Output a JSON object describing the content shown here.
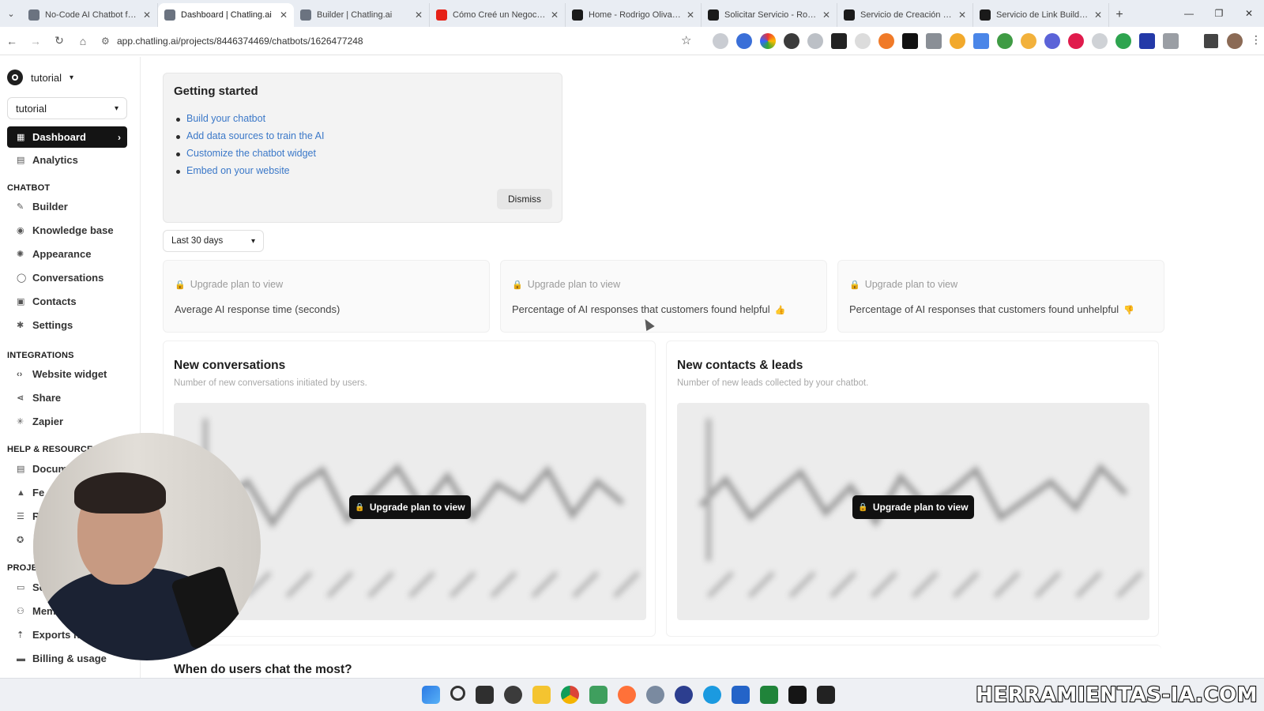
{
  "browser": {
    "tabs": [
      {
        "title": "No-Code AI Chatbot for W",
        "color": "#6b7380",
        "active": false
      },
      {
        "title": "Dashboard | Chatling.ai",
        "color": "#6b7380",
        "active": true
      },
      {
        "title": "Builder | Chatling.ai",
        "color": "#6b7380",
        "active": false
      },
      {
        "title": "Cómo Creé un Negocio d",
        "color": "#e62117",
        "active": false
      },
      {
        "title": "Home - Rodrigo Olivares",
        "color": "#1a1a1a",
        "active": false
      },
      {
        "title": "Solicitar Servicio - Rodrig",
        "color": "#1a1a1a",
        "active": false
      },
      {
        "title": "Servicio de Creación de C",
        "color": "#1a1a1a",
        "active": false
      },
      {
        "title": "Servicio de Link Building",
        "color": "#1a1a1a",
        "active": false
      }
    ],
    "new_tab": "+",
    "url": "app.chatling.ai/projects/8446374469/chatbots/1626477248"
  },
  "sidebar": {
    "workspace": "tutorial",
    "project_select": "tutorial",
    "main_items": [
      {
        "label": "Dashboard",
        "icon": "grid-icon",
        "active": true
      },
      {
        "label": "Analytics",
        "icon": "chart-icon",
        "active": false
      }
    ],
    "sections": {
      "chatbot": "CHATBOT",
      "integrations": "INTEGRATIONS",
      "help": "HELP & RESOURCES",
      "project": "PROJE"
    },
    "chatbot_items": [
      {
        "label": "Builder",
        "icon": "wrench-icon"
      },
      {
        "label": "Knowledge base",
        "icon": "book-icon"
      },
      {
        "label": "Appearance",
        "icon": "palette-icon"
      },
      {
        "label": "Conversations",
        "icon": "chat-icon"
      },
      {
        "label": "Contacts",
        "icon": "contacts-icon"
      },
      {
        "label": "Settings",
        "icon": "gear-icon"
      }
    ],
    "integration_items": [
      {
        "label": "Website widget",
        "icon": "code-icon"
      },
      {
        "label": "Share",
        "icon": "share-icon"
      },
      {
        "label": "Zapier",
        "icon": "zapier-icon"
      }
    ],
    "help_items": [
      {
        "label": "Docum",
        "icon": "doc-icon"
      },
      {
        "label": "Fe",
        "icon": "feedback-icon"
      },
      {
        "label": "R",
        "icon": "roadmap-icon"
      },
      {
        "label": "",
        "icon": "discord-icon"
      }
    ],
    "project_items": [
      {
        "label": "Se",
        "icon": "folder-icon"
      },
      {
        "label": "Mem",
        "icon": "members-icon"
      },
      {
        "label": "Exports h",
        "icon": "export-icon"
      },
      {
        "label": "Billing & usage",
        "icon": "billing-icon"
      }
    ]
  },
  "getting_started": {
    "title": "Getting started",
    "links": [
      "Build your chatbot",
      "Add data sources to train the AI",
      "Customize the chatbot widget",
      "Embed on your website"
    ],
    "dismiss": "Dismiss"
  },
  "date_range": "Last 30 days",
  "metrics": [
    {
      "lock_text": "Upgrade plan to view",
      "label": "Average AI response time (seconds)",
      "emoji": ""
    },
    {
      "lock_text": "Upgrade plan to view",
      "label": "Percentage of AI responses that customers found helpful",
      "emoji": "👍"
    },
    {
      "lock_text": "Upgrade plan to view",
      "label": "Percentage of AI responses that customers found unhelpful",
      "emoji": "👎"
    }
  ],
  "graphs": [
    {
      "title": "New conversations",
      "subtitle": "Number of new conversations initiated by users.",
      "button": "Upgrade plan to view"
    },
    {
      "title": "New contacts & leads",
      "subtitle": "Number of new leads collected by your chatbot.",
      "button": "Upgrade plan to view"
    }
  ],
  "bottom_section": {
    "title": "When do users chat the most?"
  },
  "watermark": "HERRAMIENTAS-IA.COM",
  "colors": {
    "accent_dark": "#141414",
    "link": "#3b78c8",
    "lock": "#e8b100"
  }
}
